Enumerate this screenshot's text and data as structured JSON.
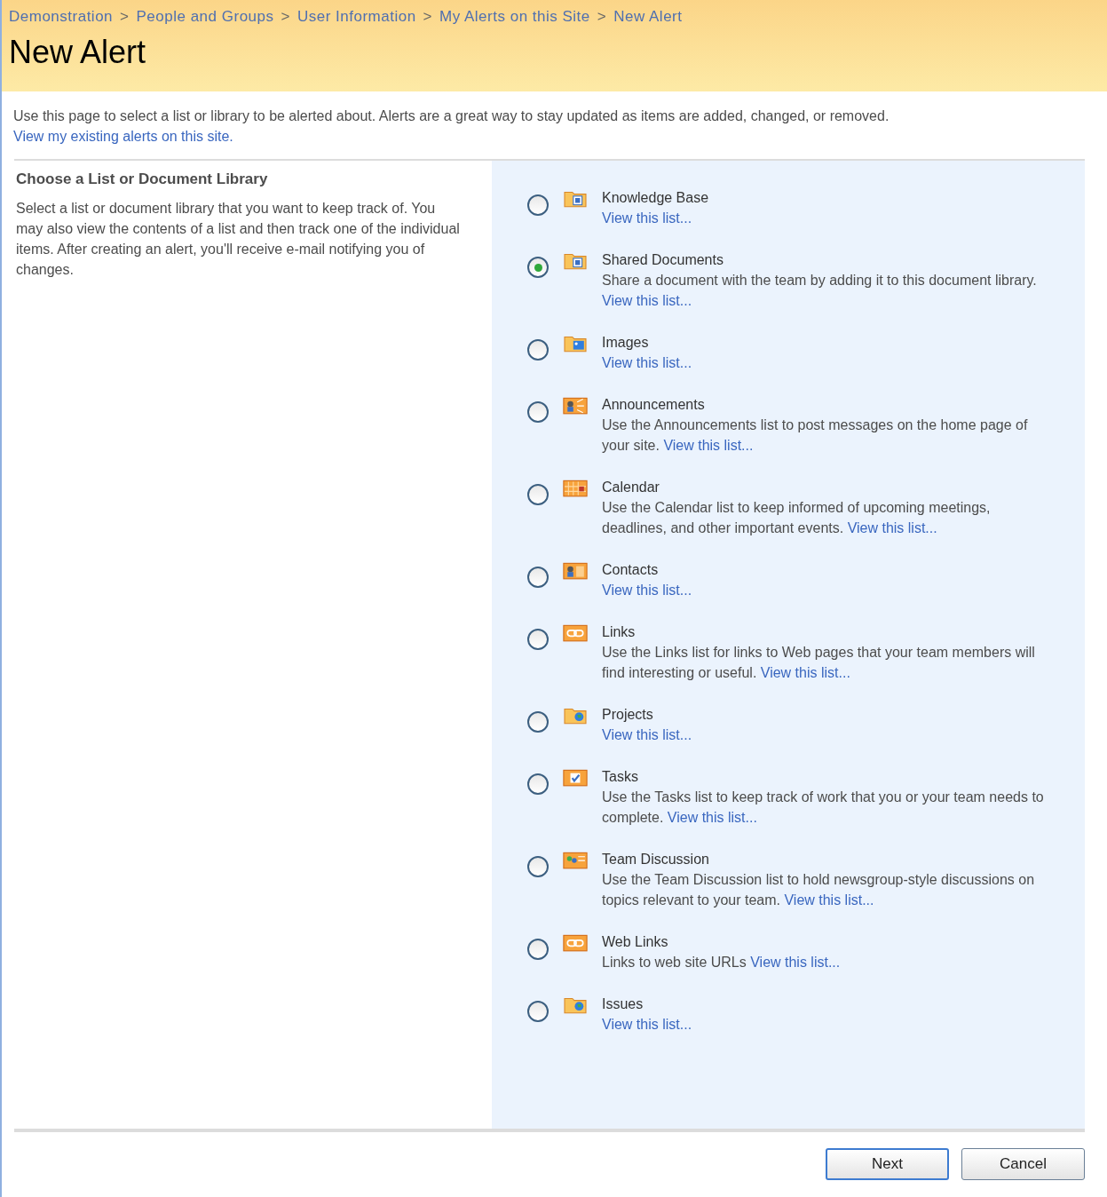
{
  "breadcrumb": [
    "Demonstration",
    "People and Groups",
    "User Information",
    "My Alerts on this Site",
    "New Alert"
  ],
  "breadcrumb_separator": ">",
  "title": "New Alert",
  "intro": {
    "text": "Use this page to select a list or library to be alerted about. Alerts are a great way to stay updated as items are added, changed, or removed.",
    "link": "View my existing alerts on this site."
  },
  "section": {
    "heading": "Choose a List or Document Library",
    "description": "Select a list or document library that you want to keep track of. You may also view the contents of a list and then track one of the individual items. After creating an alert, you'll receive e-mail notifying you of changes."
  },
  "lists": [
    {
      "name": "Knowledge Base",
      "kind": "document-folder",
      "link": "View this list...",
      "selected": false
    },
    {
      "name": "Shared Documents",
      "kind": "document-folder",
      "description": "Share a document with the team by adding it to this document library.",
      "link": "View this list...",
      "selected": true
    },
    {
      "name": "Images",
      "kind": "image-folder",
      "link": "View this list...",
      "selected": false
    },
    {
      "name": "Announcements",
      "kind": "announcement",
      "description": "Use the Announcements list to post messages on the home page of your site.",
      "link": "View this list...",
      "selected": false
    },
    {
      "name": "Calendar",
      "kind": "calendar",
      "description": "Use the Calendar list to keep informed of upcoming meetings, deadlines, and other important events.",
      "link": "View this list...",
      "selected": false
    },
    {
      "name": "Contacts",
      "kind": "contacts",
      "link": "View this list...",
      "selected": false
    },
    {
      "name": "Links",
      "kind": "links",
      "description": "Use the Links list for links to Web pages that your team members will find interesting or useful.",
      "link": "View this list...",
      "selected": false
    },
    {
      "name": "Projects",
      "kind": "projects",
      "link": "View this list...",
      "selected": false
    },
    {
      "name": "Tasks",
      "kind": "tasks",
      "description": "Use the Tasks list to keep track of work that you or your team needs to complete.",
      "link": "View this list...",
      "selected": false
    },
    {
      "name": "Team Discussion",
      "kind": "discussion",
      "description": "Use the Team Discussion list to hold newsgroup-style discussions on topics relevant to your team.",
      "link": "View this list...",
      "selected": false
    },
    {
      "name": "Web Links",
      "kind": "links",
      "description": "Links to web site URLs",
      "link": "View this list...",
      "selected": false
    },
    {
      "name": "Issues",
      "kind": "projects",
      "link": "View this list...",
      "selected": false
    }
  ],
  "buttons": [
    {
      "label": "Next",
      "default": true
    },
    {
      "label": "Cancel",
      "default": false
    }
  ]
}
